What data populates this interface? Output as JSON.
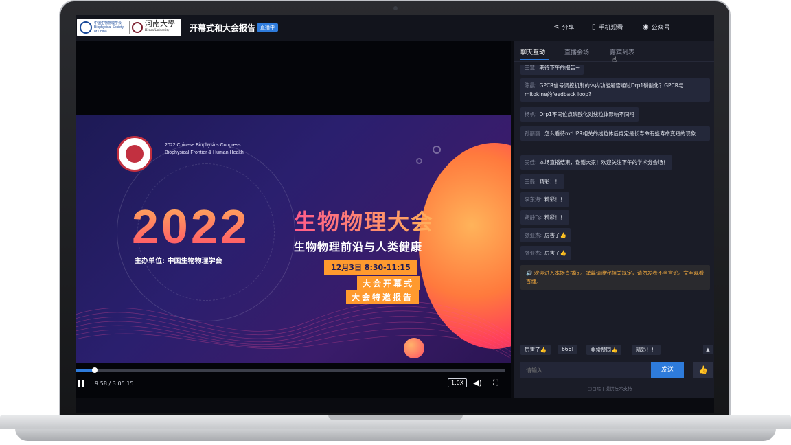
{
  "header": {
    "logo_a_text": "中国生物物理学会 Biophysical Society of China",
    "logo_b_cn": "河南大學",
    "logo_b_en": "Henan University",
    "title": "开幕式和大会报告",
    "badge": "直播中",
    "share": "分享",
    "mobile": "手机观看",
    "wechat": "公众号",
    "share_icon": "share-icon",
    "mobile_icon": "phone-icon",
    "wechat_icon": "wechat-icon"
  },
  "poster": {
    "congress_en_1": "2022 Chinese Biophysics Congress",
    "congress_en_2": "Biophysical Frontier & Human Health",
    "year": "2022",
    "title_cn": "生物物理大会",
    "subtitle_cn": "生物物理前沿与人类健康",
    "host": "主办单位: 中国生物物理学会",
    "date": "12月3日 8:30-11:15",
    "session_1": "大会开幕式",
    "session_2": "大会特邀报告"
  },
  "player": {
    "time": "9:58 / 3:05:15",
    "speed": "1.0X",
    "progress": 0.045,
    "pause_icon": "pause-icon",
    "volume_icon": "volume-icon",
    "fullscreen_icon": "fullscreen-icon"
  },
  "chat": {
    "tabs": [
      "聊天互动",
      "直播会场",
      "嘉宾列表"
    ],
    "messages": [
      {
        "name": "王慧:",
        "text": "期待下午的报告~"
      },
      {
        "name": "陈晨:",
        "text": "GPCR信号调控机制的体内功能是否通过Drp1磷酸化？GPCR与mitokine的feedback loop?"
      },
      {
        "name": "杨帆:",
        "text": "Drp1不同位点磷酸化对线粒体影响不同吗"
      },
      {
        "name": "孙丽丽:",
        "text": "怎么看待mtUPR相关的线粒体后肯定是长寿命有些寿命变短的现象"
      },
      {
        "name": "吴佳:",
        "text": "本场直播结束，谢谢大家！欢迎关注下午的学术分会场！"
      },
      {
        "name": "王磊:",
        "text": "精彩！！"
      },
      {
        "name": "李东海:",
        "text": "精彩！！"
      },
      {
        "name": "胡静飞:",
        "text": "精彩！！"
      },
      {
        "name": "张亚杰:",
        "text": "厉害了👍"
      },
      {
        "name": "张亚杰:",
        "text": "厉害了👍"
      }
    ],
    "notice": "🔊 欢迎进入本场直播间。弹幕请遵守相关规定，请勿发表不当言论。文明观看直播。",
    "quick_replies": [
      "厉害了👍",
      "666!",
      "非常赞同👍",
      "精彩！！"
    ],
    "input_placeholder": "请输入",
    "send": "发送",
    "like_icon": "thumbs-up-icon",
    "collapse_icon": "chevron-up-icon",
    "powered_by": "▢目睹 | 提供技术支持"
  }
}
